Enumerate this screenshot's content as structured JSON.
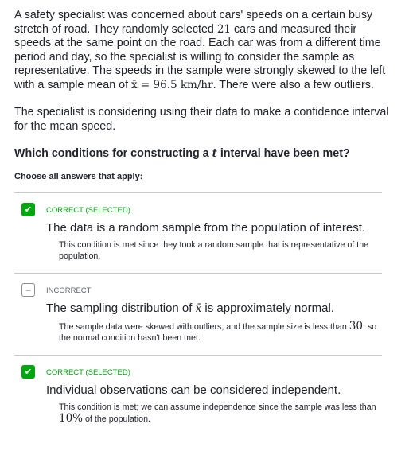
{
  "question": {
    "p1_parts": [
      "A safety specialist was concerned about cars' speeds on a certain busy stretch of road. They randomly selected ",
      "21",
      " cars and measured their speeds at the same point on the road. Each car was from a different time period and day, so the specialist is willing to consider the sample as representative. The speeds in the sample were strongly skewed to the left with a sample mean of ",
      "x̄ = 96.5 km/hr",
      ". There were also a few outliers."
    ],
    "p2": "The specialist is considering using their data to make a confidence interval for the mean speed.",
    "ask_pre": "Which conditions for constructing a ",
    "ask_var": "t",
    "ask_post": " interval have been met?",
    "choose": "Choose all answers that apply:"
  },
  "options": [
    {
      "status": "CORRECT (SELECTED)",
      "icon": "check",
      "text": "The data is a random sample from the population of interest.",
      "explanation": "This condition is met since they took a random sample that is representative of the population."
    },
    {
      "status": "INCORRECT",
      "icon": "minus",
      "text_pre": "The sampling distribution of ",
      "text_var": "x̄",
      "text_post": " is approximately normal.",
      "exp_pre": "The sample data were skewed with outliers, and the sample size is less than ",
      "exp_num": "30",
      "exp_post": ", so the normal condition hasn't been met."
    },
    {
      "status": "CORRECT (SELECTED)",
      "icon": "check",
      "text": "Individual observations can be considered independent.",
      "exp_pre": "This condition is met; we can assume independence since the sample was less than ",
      "exp_num": "10%",
      "exp_post": " of the population."
    }
  ],
  "colors": {
    "correct": "#00a60e",
    "incorrect": "#626569"
  }
}
